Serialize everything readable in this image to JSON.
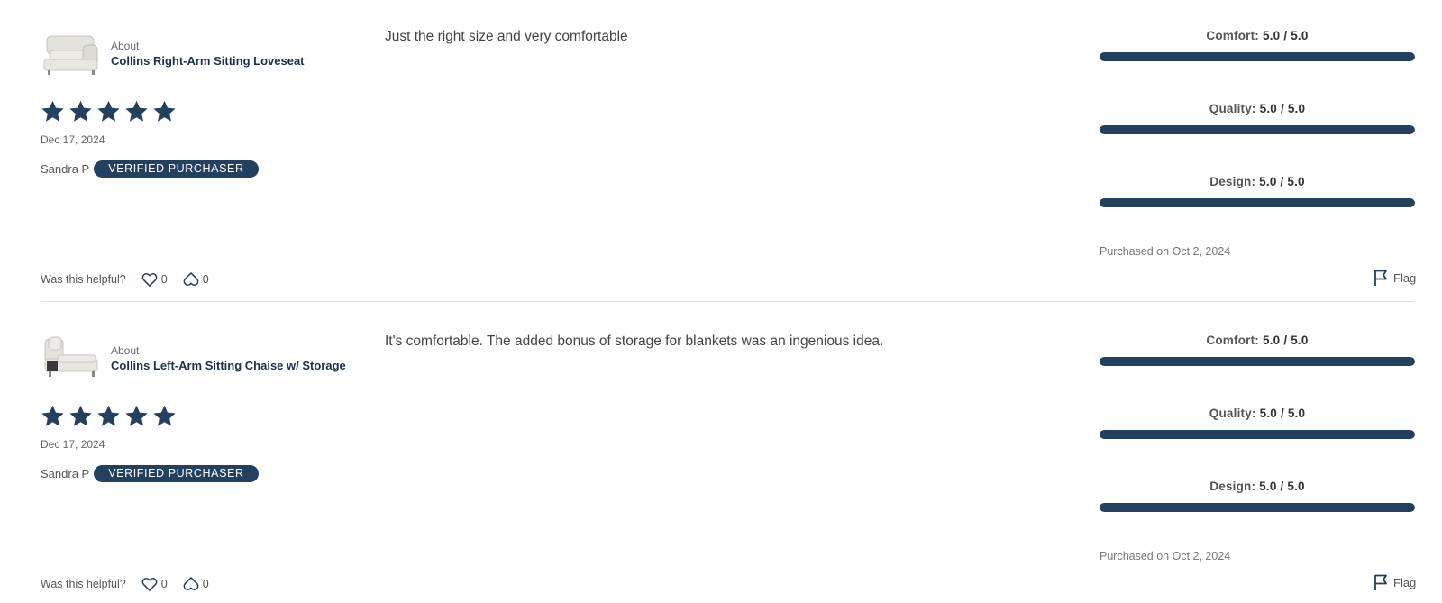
{
  "colors": {
    "accent": "#23405f",
    "text": "#333333",
    "muted": "#666666",
    "divider": "#e1e1e1"
  },
  "reviews": [
    {
      "about_label": "About",
      "product": "Collins Right-Arm Sitting Loveseat",
      "thumbnail_icon": "loveseat-image",
      "rating": 5,
      "date": "Dec 17, 2024",
      "author": "Sandra P",
      "badge": "VERIFIED PURCHASER",
      "body": "Just the right size and very comfortable",
      "metrics": [
        {
          "label": "Comfort:",
          "value": "5.0 / 5.0",
          "fraction": 1.0
        },
        {
          "label": "Quality:",
          "value": "5.0 / 5.0",
          "fraction": 1.0
        },
        {
          "label": "Design:",
          "value": "5.0 / 5.0",
          "fraction": 1.0
        }
      ],
      "purchased": "Purchased on Oct 2, 2024",
      "helpful_label": "Was this helpful?",
      "likes": "0",
      "dislikes": "0",
      "flag_label": "Flag"
    },
    {
      "about_label": "About",
      "product": "Collins Left-Arm Sitting Chaise w/ Storage",
      "thumbnail_icon": "chaise-image",
      "rating": 5,
      "date": "Dec 17, 2024",
      "author": "Sandra P",
      "badge": "VERIFIED PURCHASER",
      "body": "It's comfortable. The added bonus of storage for blankets was an ingenious idea.",
      "metrics": [
        {
          "label": "Comfort:",
          "value": "5.0 / 5.0",
          "fraction": 1.0
        },
        {
          "label": "Quality:",
          "value": "5.0 / 5.0",
          "fraction": 1.0
        },
        {
          "label": "Design:",
          "value": "5.0 / 5.0",
          "fraction": 1.0
        }
      ],
      "purchased": "Purchased on Oct 2, 2024",
      "helpful_label": "Was this helpful?",
      "likes": "0",
      "dislikes": "0",
      "flag_label": "Flag"
    }
  ]
}
